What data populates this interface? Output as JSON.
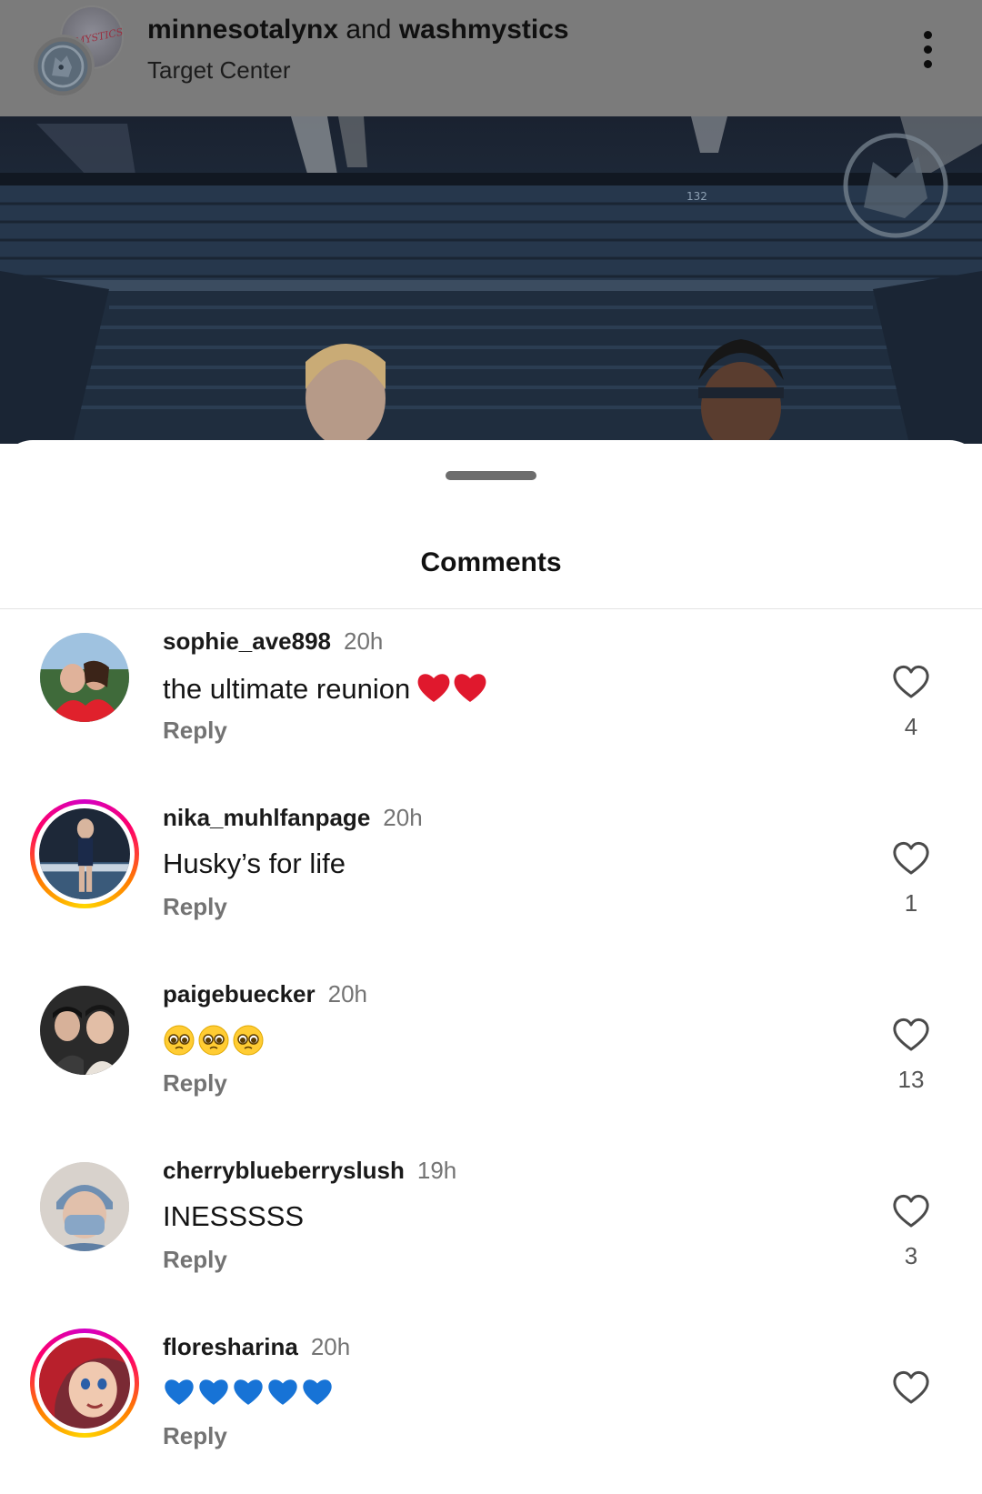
{
  "post": {
    "author_primary": "minnesotalynx",
    "author_joiner": "and",
    "author_secondary": "washmystics",
    "location": "Target Center",
    "collab_logo_text": "MYSTICS"
  },
  "sheet": {
    "title": "Comments"
  },
  "comments": [
    {
      "username": "sophie_ave898",
      "time": "20h",
      "text": "the ultimate reunion",
      "emoji": [
        "red-heart",
        "red-heart"
      ],
      "reply_label": "Reply",
      "likes": "4"
    },
    {
      "username": "nika_muhlfanpage",
      "time": "20h",
      "text": "Husky’s for life",
      "emoji": [],
      "reply_label": "Reply",
      "likes": "1",
      "story_ring": true
    },
    {
      "username": "paigebuecker",
      "time": "20h",
      "text": "",
      "emoji": [
        "pleading-face",
        "pleading-face",
        "pleading-face"
      ],
      "reply_label": "Reply",
      "likes": "13"
    },
    {
      "username": "cherryblueberryslush",
      "time": "19h",
      "text": "INESSSSS",
      "emoji": [],
      "reply_label": "Reply",
      "likes": "3"
    },
    {
      "username": "floresharina",
      "time": "20h",
      "text": "",
      "emoji": [
        "blue-heart",
        "blue-heart",
        "blue-heart",
        "blue-heart",
        "blue-heart"
      ],
      "reply_label": "Reply",
      "likes": "",
      "story_ring": true
    }
  ],
  "colors": {
    "overlay_dim": "#7b7b7b",
    "muted_text": "#737373",
    "red_heart": "#e0182d",
    "blue_heart": "#1773d6"
  }
}
